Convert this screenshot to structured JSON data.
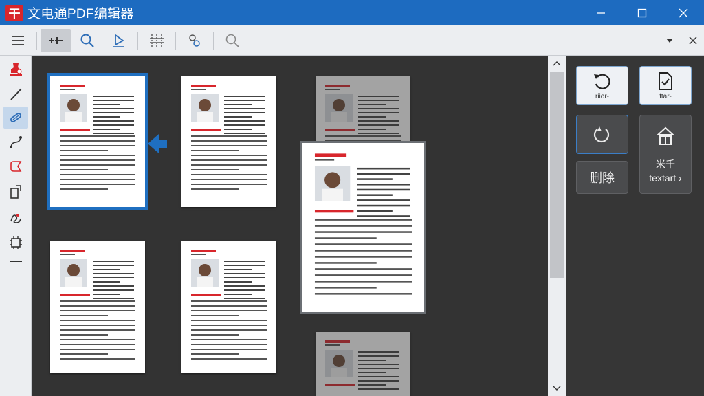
{
  "app": {
    "title": "文电通PDF编辑器",
    "logo_glyph": "干",
    "brand_color": "#1d6bc0",
    "logo_color": "#d8262c"
  },
  "window_controls": [
    "minimize-icon",
    "maximize-icon",
    "close-icon"
  ],
  "toolbar": {
    "buttons": [
      "menu-icon",
      "page-organize-icon",
      "search-icon",
      "select-pointer-icon",
      "split-page-icon",
      "link-icon",
      "zoom-icon"
    ],
    "active": "page-organize-icon",
    "right": [
      "dropdown-icon",
      "close-panel-icon"
    ]
  },
  "left_tools": [
    "stamp-icon",
    "pen-icon",
    "link-icon",
    "bezier-icon",
    "shape-icon",
    "extract-icon",
    "signature-icon",
    "chip-icon"
  ],
  "pages": [
    {
      "id": "page-1",
      "state": "selected",
      "caption": ""
    },
    {
      "id": "page-2",
      "state": "normal",
      "caption": ""
    },
    {
      "id": "page-3",
      "state": "dimmed",
      "caption": ""
    },
    {
      "id": "page-4",
      "state": "normal",
      "caption": ""
    },
    {
      "id": "page-5",
      "state": "normal",
      "caption": ""
    },
    {
      "id": "page-6",
      "state": "dimmed",
      "caption": ""
    },
    {
      "id": "page-drag",
      "state": "dragging",
      "caption": ""
    }
  ],
  "right_panel": {
    "rotate_left": {
      "label": "riior-",
      "icon": "rotate-left-icon"
    },
    "extract_page": {
      "label": "ftar-",
      "icon": "page-check-icon"
    },
    "rotate_right": {
      "label": "",
      "icon": "rotate-right-icon"
    },
    "insert": {
      "label_top": "米千",
      "label_bottom": "textart ›",
      "icon": "insert-page-icon"
    },
    "delete": {
      "label": "删除",
      "icon": ""
    }
  }
}
